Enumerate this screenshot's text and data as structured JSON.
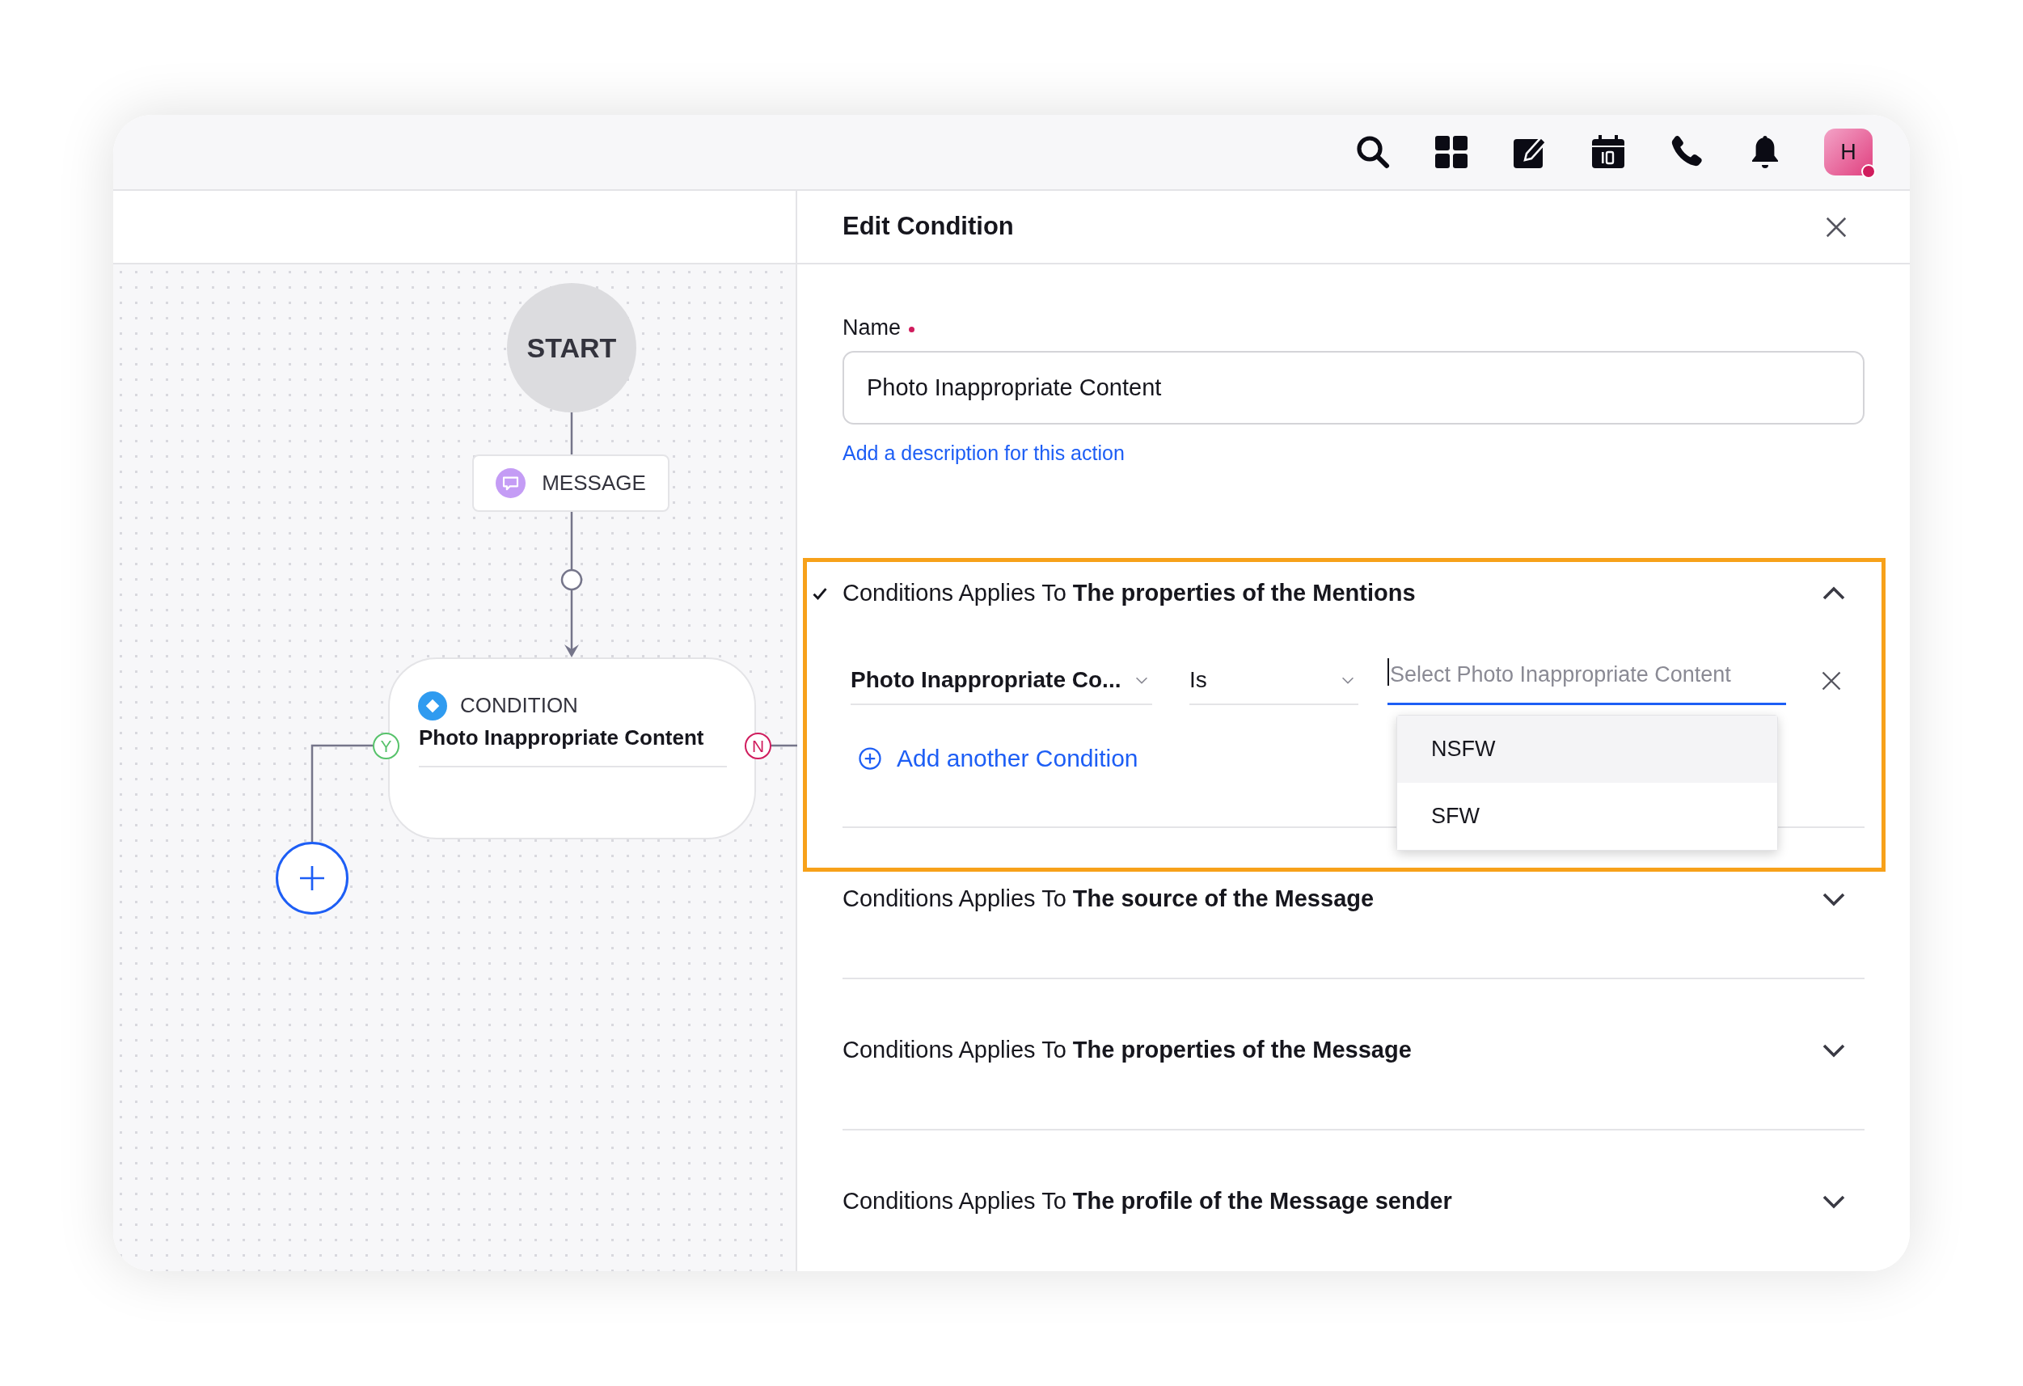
{
  "top_bar": {
    "avatar": {
      "initial": "H",
      "online": true
    }
  },
  "flow": {
    "nodes": [
      {
        "kind": "start",
        "label": "START"
      },
      {
        "kind": "message",
        "label": "MESSAGE"
      },
      {
        "kind": "condition",
        "type_label": "CONDITION",
        "title": "Photo Inappropriate Content",
        "yes_label": "Y",
        "no_label": "N"
      }
    ]
  },
  "panel": {
    "title": "Edit Condition",
    "name_label": "Name",
    "required": true,
    "name_value": "Photo Inappropriate Content",
    "description_link": "Add a description for this action",
    "sections": [
      {
        "label": "Conditions Applies To **The properties of the Mentions**",
        "checked": true,
        "expanded": true,
        "highlighted": true,
        "rows": [
          {
            "field": "Photo Inappropriate Co...",
            "operator": "Is",
            "value_placeholder": "Select Photo Inappropriate Content",
            "focused": true,
            "options": [
              {
                "label": "NSFW",
                "highlighted": true
              },
              {
                "label": "SFW",
                "highlighted": false
              }
            ]
          }
        ],
        "add_label": "Add another Condition"
      },
      {
        "label": "Conditions Applies To **The source of the Message**",
        "checked": false,
        "expanded": false,
        "highlighted": false
      },
      {
        "label": "Conditions Applies To **The properties of the Message**",
        "checked": false,
        "expanded": false,
        "highlighted": false
      },
      {
        "label": "Conditions Applies To **The profile of the Message sender**",
        "checked": false,
        "expanded": false,
        "highlighted": false
      }
    ]
  }
}
